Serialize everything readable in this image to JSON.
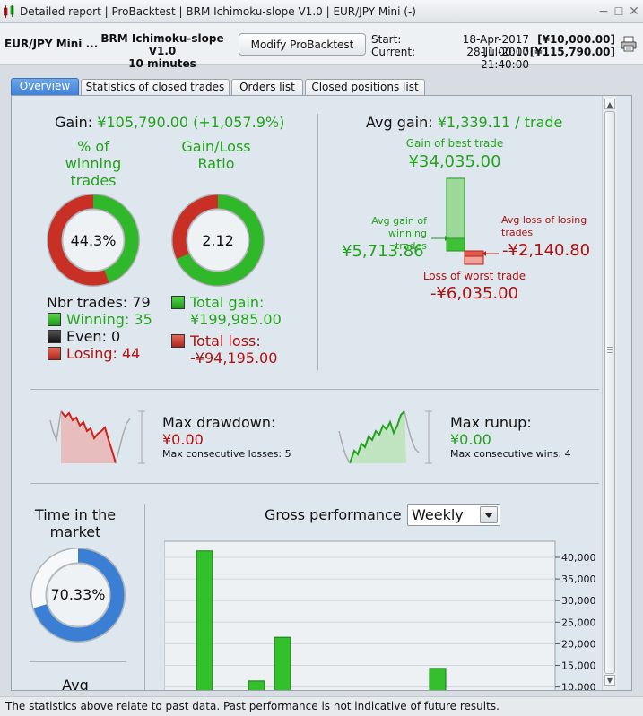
{
  "window": {
    "title": "Detailed report | ProBacktest | BRM Ichimoku-slope V1.0 | EUR/JPY Mini (-)",
    "icons": [
      "app-chart-icon",
      "minimize-icon",
      "maximize-icon",
      "close-icon"
    ]
  },
  "header": {
    "instrument": "EUR/JPY Mini ...",
    "system_name": "BRM Ichimoku-slope V1.0",
    "timeframe": "10 minutes",
    "modify_button": "Modify ProBacktest",
    "start_label": "Start:",
    "start_date": "18-Apr-2017 11:00:00",
    "start_capital": "[¥10,000.00]",
    "current_label": "Current:",
    "current_date": "28-Jul-2017 21:40:00",
    "current_capital": "[¥115,790.00]",
    "print_icon": "printer-icon"
  },
  "tabs": [
    "Overview",
    "Statistics of closed trades",
    "Orders list",
    "Closed positions list"
  ],
  "overview": {
    "gain_label": "Gain:",
    "gain_value": "¥105,790.00 (+1,057.9%)",
    "pct_winning_label_1": "% of",
    "pct_winning_label_2": "winning",
    "pct_winning_label_3": "trades",
    "pct_winning_value": "44.3%",
    "pct_winning_fraction": 0.443,
    "ratio_label_1": "Gain/Loss",
    "ratio_label_2": "Ratio",
    "ratio_value": "2.12",
    "ratio_fraction": 0.68,
    "nbr_trades": "Nbr trades: 79",
    "winning": "Winning: 35",
    "even": "Even: 0",
    "losing": "Losing: 44",
    "total_gain_label": "Total gain:",
    "total_gain_value": "¥199,985.00",
    "total_loss_label": "Total loss:",
    "total_loss_value": "-¥94,195.00",
    "avg_gain_label": "Avg gain:",
    "avg_gain_value": "¥1,339.11 / trade",
    "best_trade_label": "Gain of best trade",
    "best_trade_value": "¥34,035.00",
    "avg_win_label_1": "Avg gain of",
    "avg_win_label_2": "winning trades",
    "avg_win_value": "¥5,713.86",
    "avg_loss_label_1": "Avg loss of losing",
    "avg_loss_label_2": "trades",
    "avg_loss_value": "-¥2,140.80",
    "worst_trade_label": "Loss of worst trade",
    "worst_trade_value": "-¥6,035.00",
    "max_drawdown_label": "Max drawdown:",
    "max_drawdown_value": "¥0.00",
    "max_consec_losses": "Max consecutive losses: 5",
    "max_runup_label": "Max runup:",
    "max_runup_value": "¥0.00",
    "max_consec_wins": "Max consecutive wins: 4",
    "time_in_market_label_1": "Time in the",
    "time_in_market_label_2": "market",
    "time_in_market_value": "70.33%",
    "time_in_market_fraction": 0.7033,
    "avg_label_partial": "Avg",
    "gross_performance_label": "Gross performance",
    "period_select": "Weekly",
    "colors": {
      "green": "#23a31c",
      "red": "#b01010",
      "blue": "#3b7fd4"
    }
  },
  "chart_data": {
    "type": "bar",
    "title": "Gross performance",
    "yticks": [
      "40,000",
      "35,000",
      "30,000",
      "25,000",
      "20,000",
      "15,000",
      "10,000"
    ],
    "ylim": [
      10000,
      42000
    ],
    "visible_bars": [
      41500,
      11400,
      21500,
      14300
    ]
  },
  "status": {
    "text": "The statistics above relate to past data. Past performance is not indicative of future results."
  }
}
